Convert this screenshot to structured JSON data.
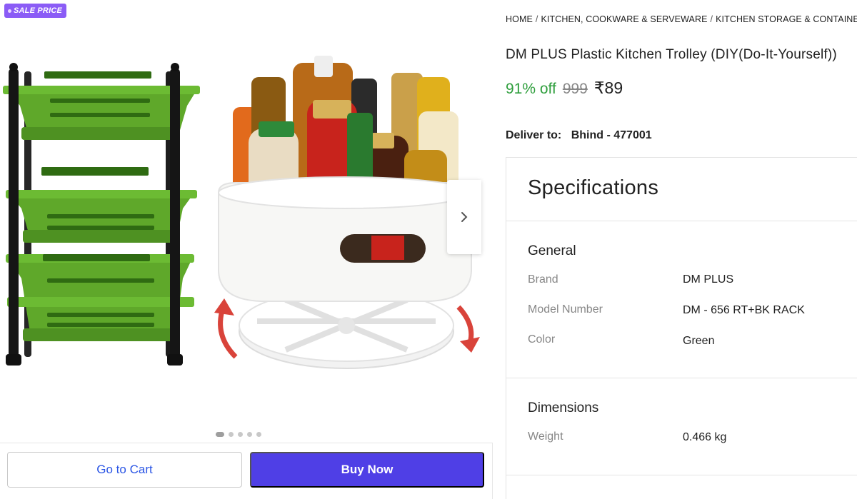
{
  "gallery": {
    "badge_label": "SALE PRICE",
    "current_slide": 1,
    "slide_count": 5
  },
  "actions": {
    "go_to_cart_label": "Go to Cart",
    "buy_now_label": "Buy Now"
  },
  "breadcrumb": [
    "HOME",
    "KITCHEN, COOKWARE & SERVEWARE",
    "KITCHEN STORAGE & CONTAINERS"
  ],
  "product": {
    "title": "DM PLUS Plastic Kitchen Trolley (DIY(Do-It-Yourself))",
    "discount": "91% off",
    "mrp": "999",
    "price": "₹89"
  },
  "delivery": {
    "label": "Deliver to:",
    "location": "Bhind - 477001"
  },
  "specifications": {
    "heading": "Specifications",
    "general": {
      "title": "General",
      "rows": [
        {
          "key": "Brand",
          "value": "DM PLUS"
        },
        {
          "key": "Model Number",
          "value": "DM - 656 RT+BK RACK"
        },
        {
          "key": "Color",
          "value": "Green"
        }
      ]
    },
    "dimensions": {
      "title": "Dimensions",
      "rows": [
        {
          "key": "Weight",
          "value": "0.466 kg"
        }
      ]
    }
  },
  "colors": {
    "badge": "#8b5cf6",
    "discount": "#2e9e3c",
    "buy_button": "#4f3fe6",
    "cart_text": "#2a55e5",
    "basket_green": "#5fa82a"
  }
}
